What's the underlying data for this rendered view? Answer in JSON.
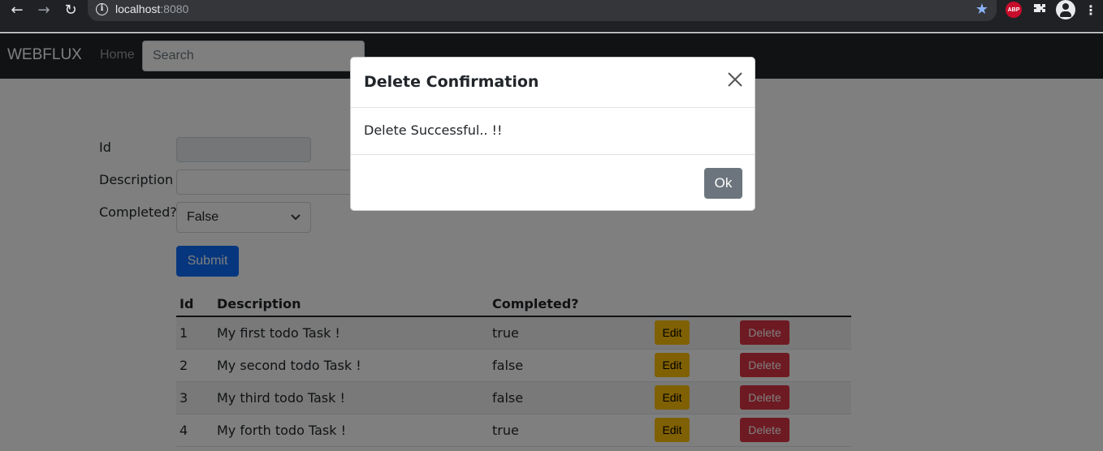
{
  "browser": {
    "url_host": "localhost",
    "url_port": ":8080",
    "ext_abp": "ABP"
  },
  "navbar": {
    "brand": "WEBFLUX",
    "home": "Home",
    "search_placeholder": "Search"
  },
  "form": {
    "id_label": "Id",
    "description_label": "Description",
    "completed_label": "Completed?",
    "completed_value": "False",
    "submit_label": "Submit"
  },
  "table": {
    "headers": [
      "Id",
      "Description",
      "Completed?"
    ],
    "edit_label": "Edit",
    "delete_label": "Delete",
    "rows": [
      {
        "id": "1",
        "description": "My first todo Task !",
        "completed": "true"
      },
      {
        "id": "2",
        "description": "My second todo Task !",
        "completed": "false"
      },
      {
        "id": "3",
        "description": "My third todo Task !",
        "completed": "false"
      },
      {
        "id": "4",
        "description": "My forth todo Task !",
        "completed": "true"
      }
    ]
  },
  "modal": {
    "title": "Delete Confirmation",
    "close_symbol": "×",
    "message": "Delete Successful.. !!",
    "ok_label": "Ok"
  },
  "colors": {
    "primary": "#0d6efd",
    "warning": "#ffc107",
    "danger": "#dc3545",
    "secondary": "#6c757d",
    "navbar": "#212529"
  }
}
